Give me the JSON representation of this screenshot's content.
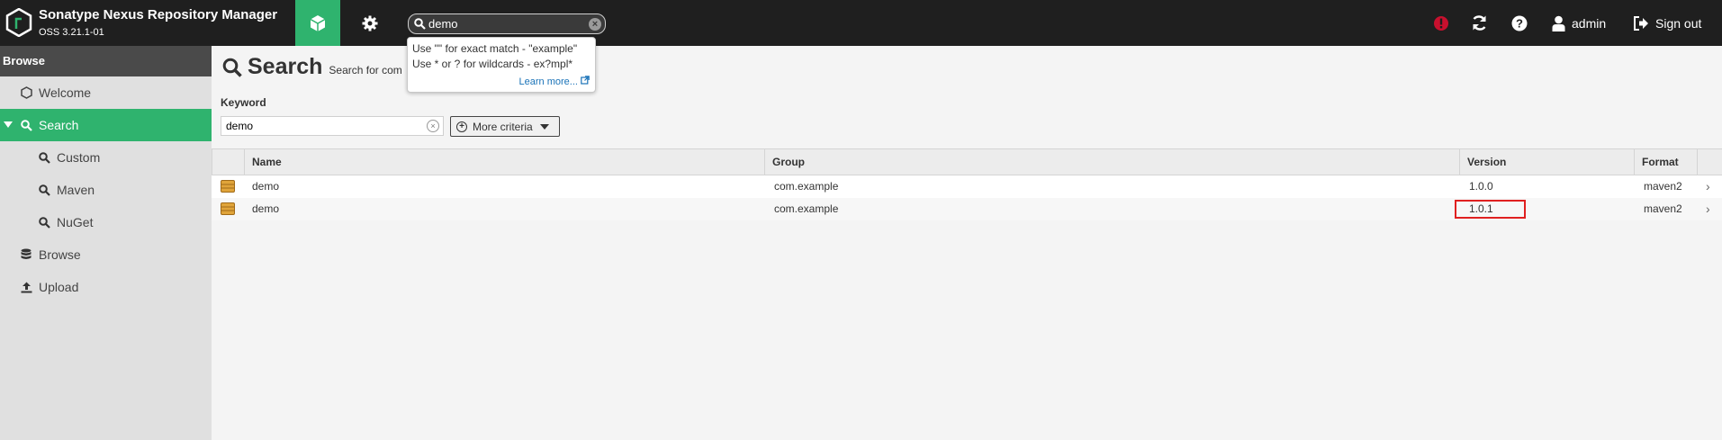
{
  "header": {
    "brand_title": "Sonatype Nexus Repository Manager",
    "brand_version": "OSS 3.21.1-01",
    "search_value": "demo",
    "username": "admin",
    "signout_label": "Sign out",
    "accent_color": "#2fb36e",
    "alert_color": "#c8102e"
  },
  "tooltip": {
    "line1": "Use \"\" for exact match - \"example\"",
    "line2": "Use * or ? for wildcards - ex?mpl*",
    "learn_more": "Learn more..."
  },
  "sidebar": {
    "heading": "Browse",
    "items": [
      {
        "label": "Welcome",
        "icon": "hexagon-icon"
      },
      {
        "label": "Search",
        "icon": "search-icon"
      },
      {
        "label": "Custom",
        "icon": "search-icon"
      },
      {
        "label": "Maven",
        "icon": "search-icon"
      },
      {
        "label": "NuGet",
        "icon": "search-icon"
      },
      {
        "label": "Browse",
        "icon": "database-icon"
      },
      {
        "label": "Upload",
        "icon": "upload-icon"
      }
    ]
  },
  "main": {
    "title": "Search",
    "subtitle": "Search for com",
    "keyword_label": "Keyword",
    "keyword_value": "demo",
    "more_criteria": "More criteria"
  },
  "grid": {
    "columns": [
      "Name",
      "Group",
      "Version",
      "Format"
    ],
    "rows": [
      {
        "name": "demo",
        "group": "com.example",
        "version": "1.0.0",
        "format": "maven2"
      },
      {
        "name": "demo",
        "group": "com.example",
        "version": "1.0.1",
        "format": "maven2"
      }
    ]
  }
}
